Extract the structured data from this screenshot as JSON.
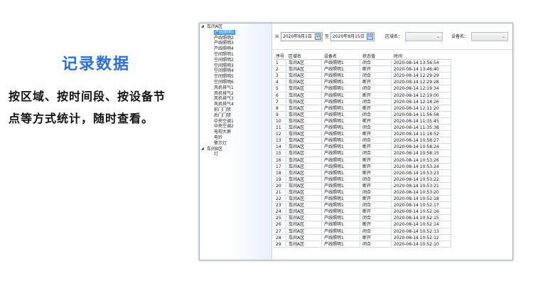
{
  "promo": {
    "title": "记录数据",
    "desc_line1": "按区域、按时间段、按设备节",
    "desc_line2": "点等方式统计，随时查看。"
  },
  "tree": {
    "groups": [
      {
        "label": "车间A区",
        "toggle": "◢",
        "items": [
          "产线照明1",
          "产线照明2",
          "产线照明3",
          "产线照明4",
          "空间照明1",
          "空间照明2",
          "空间照明3",
          "空间照明4",
          "空间照明5",
          "空间照明6",
          "风机排气1",
          "风机排气2",
          "风机排气3",
          "风机排气4",
          "前门门禁",
          "后门门禁",
          "中央空调1",
          "中央空调2",
          "电视大屏",
          "电铃",
          "警示灯"
        ]
      },
      {
        "label": "车间B区",
        "toggle": "◢",
        "items": [
          "灯"
        ]
      }
    ],
    "selected_item": "产线照明1"
  },
  "filter": {
    "from_label": "从",
    "from_date": "2020年8月1日",
    "to_label": "至",
    "to_date": "2020年8月15日",
    "calendar_glyph": "15",
    "area_label": "区域名：",
    "area_value": "",
    "device_label": "设备名：",
    "device_value": ""
  },
  "grid": {
    "columns": [
      "序号",
      "区域名",
      "设备名",
      "状态值",
      "时间"
    ],
    "rows": [
      [
        "1",
        "车间A区",
        "产线照明1",
        "闭合",
        "2020-08-14 13:56:54"
      ],
      [
        "2",
        "车间A区",
        "产线照明1",
        "断开",
        "2020-08-14 13:46:40"
      ],
      [
        "3",
        "车间A区",
        "产线照明1",
        "闭合",
        "2020-08-14 12:29:29"
      ],
      [
        "4",
        "车间A区",
        "产线照明1",
        "断开",
        "2020-08-14 12:29:28"
      ],
      [
        "5",
        "车间A区",
        "产线照明1",
        "闭合",
        "2020-08-14 12:19:34"
      ],
      [
        "6",
        "车间A区",
        "产线照明1",
        "断开",
        "2020-08-14 12:19:00"
      ],
      [
        "7",
        "车间A区",
        "产线照明1",
        "闭合",
        "2020-08-14 12:18:26"
      ],
      [
        "8",
        "车间A区",
        "产线照明1",
        "断开",
        "2020-08-14 12:11:20"
      ],
      [
        "9",
        "车间A区",
        "产线照明1",
        "闭合",
        "2020-08-14 11:56:58"
      ],
      [
        "10",
        "车间A区",
        "产线照明1",
        "断开",
        "2020-08-14 11:35:45"
      ],
      [
        "11",
        "车间A区",
        "产线照明1",
        "闭合",
        "2020-08-14 11:35:38"
      ],
      [
        "12",
        "车间A区",
        "产线照明1",
        "断开",
        "2020-08-14 11:18:52"
      ],
      [
        "13",
        "车间A区",
        "产线照明1",
        "闭合",
        "2020-08-14 10:58:27"
      ],
      [
        "14",
        "车间A区",
        "产线照明1",
        "断开",
        "2020-08-14 10:58:24"
      ],
      [
        "15",
        "车间A区",
        "产线照明1",
        "闭合",
        "2020-08-14 10:58:15"
      ],
      [
        "16",
        "车间A区",
        "产线照明1",
        "断开",
        "2020-08-14 10:53:26"
      ],
      [
        "17",
        "车间A区",
        "产线照明1",
        "断开",
        "2020-08-14 10:53:24"
      ],
      [
        "18",
        "车间A区",
        "产线照明1",
        "断开",
        "2020-08-14 10:53:23"
      ],
      [
        "19",
        "车间A区",
        "产线照明1",
        "闭合",
        "2020-08-14 10:53:22"
      ],
      [
        "20",
        "车间A区",
        "产线照明1",
        "断开",
        "2020-08-14 10:53:21"
      ],
      [
        "21",
        "车间A区",
        "产线照明1",
        "闭合",
        "2020-08-14 10:53:20"
      ],
      [
        "22",
        "车间A区",
        "产线照明1",
        "断开",
        "2020-08-14 10:52:18"
      ],
      [
        "23",
        "车间A区",
        "产线照明1",
        "闭合",
        "2020-08-14 10:52:17"
      ],
      [
        "24",
        "车间A区",
        "产线照明1",
        "断开",
        "2020-08-14 10:52:16"
      ],
      [
        "25",
        "车间A区",
        "产线照明1",
        "闭合",
        "2020-08-14 10:52:15"
      ],
      [
        "26",
        "车间A区",
        "产线照明1",
        "断开",
        "2020-08-14 10:52:14"
      ],
      [
        "27",
        "车间A区",
        "产线照明1",
        "闭合",
        "2020-08-14 10:52:13"
      ],
      [
        "28",
        "车间A区",
        "产线照明1",
        "断开",
        "2020-08-14 10:52:12"
      ],
      [
        "29",
        "车间A区",
        "产线照明1",
        "闭合",
        "2020-08-14 10:52:10"
      ]
    ]
  },
  "colors": {
    "title_blue": "#2b6fd6",
    "selection_blue": "#3399ff"
  }
}
